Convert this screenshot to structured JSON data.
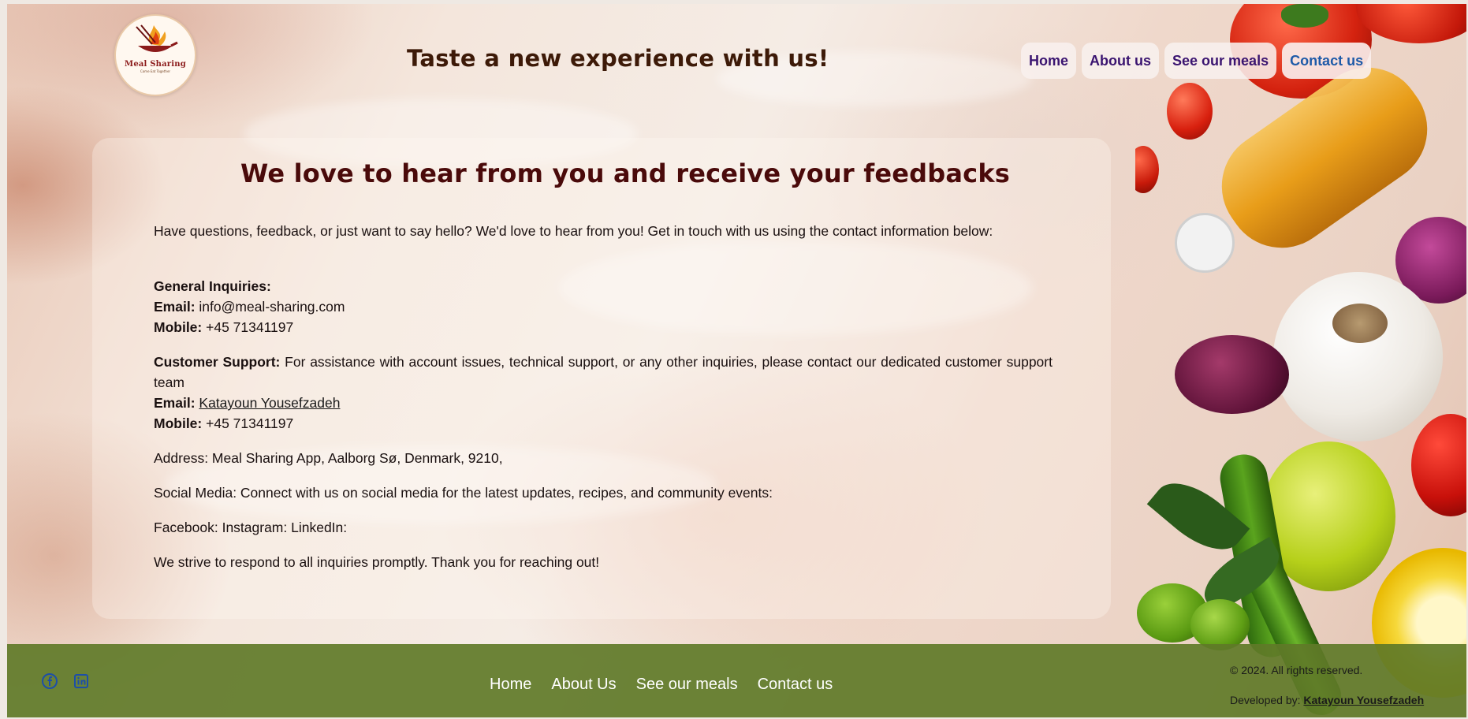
{
  "header": {
    "logo_title": "Meal Sharing",
    "logo_sub": "Come Eat Together",
    "tagline": "Taste a new experience with us!"
  },
  "nav": {
    "items": [
      {
        "label": "Home"
      },
      {
        "label": "About us"
      },
      {
        "label": "See our meals"
      },
      {
        "label": "Contact us"
      }
    ],
    "active": "Contact us",
    "colors": {
      "default": "#3a1470",
      "active": "#1e5aa8"
    }
  },
  "main": {
    "heading": "We love to hear from you and receive your feedbacks",
    "intro": "Have questions, feedback, or just want to say hello? We'd love to hear from you! Get in touch with us using the contact information below:",
    "general": {
      "title": "General Inquiries:",
      "email_label": "Email:",
      "email_value": "info@meal-sharing.com",
      "mobile_label": "Mobile:",
      "mobile_value": "+45 71341197"
    },
    "support": {
      "title": "Customer Support:",
      "text": "For assistance with account issues, technical support, or any other inquiries, please contact our dedicated customer support team",
      "email_label": "Email:",
      "email_link": "Katayoun Yousefzadeh",
      "mobile_label": "Mobile:",
      "mobile_value": "+45 71341197"
    },
    "address": "Address: Meal Sharing App, Aalborg Sø, Denmark, 9210,",
    "social_media": "Social Media: Connect with us on social media for the latest updates, recipes, and community events:",
    "social_links": "Facebook: Instagram: LinkedIn:",
    "closing": "We strive to respond to all inquiries promptly. Thank you for reaching out!"
  },
  "footer": {
    "social_icons": [
      "facebook-icon",
      "linkedin-icon"
    ],
    "nav": [
      {
        "label": "Home"
      },
      {
        "label": "About Us"
      },
      {
        "label": "See our meals"
      },
      {
        "label": "Contact us"
      }
    ],
    "copyright": "© 2024. All rights reserved.",
    "developed_label": "Developed by:",
    "developed_name": "Katayoun Yousefzadeh",
    "background": "#607a28"
  }
}
